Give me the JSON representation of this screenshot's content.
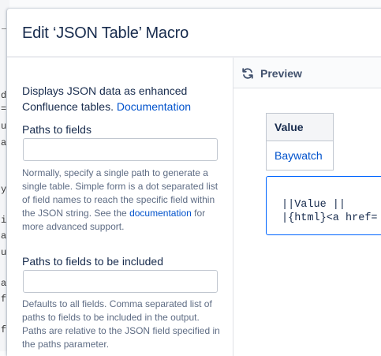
{
  "background_editor": {
    "glyphs": [
      "d",
      "=",
      "u",
      "a",
      "y",
      "i",
      "a",
      "u",
      "a",
      "f",
      "f"
    ]
  },
  "dialog": {
    "title": "Edit ‘JSON Table’ Macro"
  },
  "form": {
    "description": "Displays JSON data as enhanced Confluence tables.",
    "description_link": "Documentation",
    "paths": {
      "label": "Paths to fields",
      "value": "",
      "help_before_link": "Normally, specify a single path to generate a single table. Simple form is a dot separated list of field names to reach the specific field within the JSON string. See the",
      "help_link": "documentation",
      "help_after_link": "for more advanced support."
    },
    "paths_included": {
      "label": "Paths to fields to be included",
      "value": "",
      "help": "Defaults to all fields. Comma separated list of paths to fields to be included in the output. Paths are relative to the JSON field specified in the paths parameter."
    }
  },
  "preview": {
    "button_label": "Preview",
    "icon": "refresh-icon",
    "table": {
      "header": "Value",
      "rows": [
        "Baywatch"
      ]
    },
    "code_lines": [
      "||Value ||",
      "|{html}<a href="
    ]
  },
  "colors": {
    "link": "#0052cc",
    "text": "#172b4d",
    "muted": "#5e6c84",
    "focus_border": "#0065ff"
  }
}
